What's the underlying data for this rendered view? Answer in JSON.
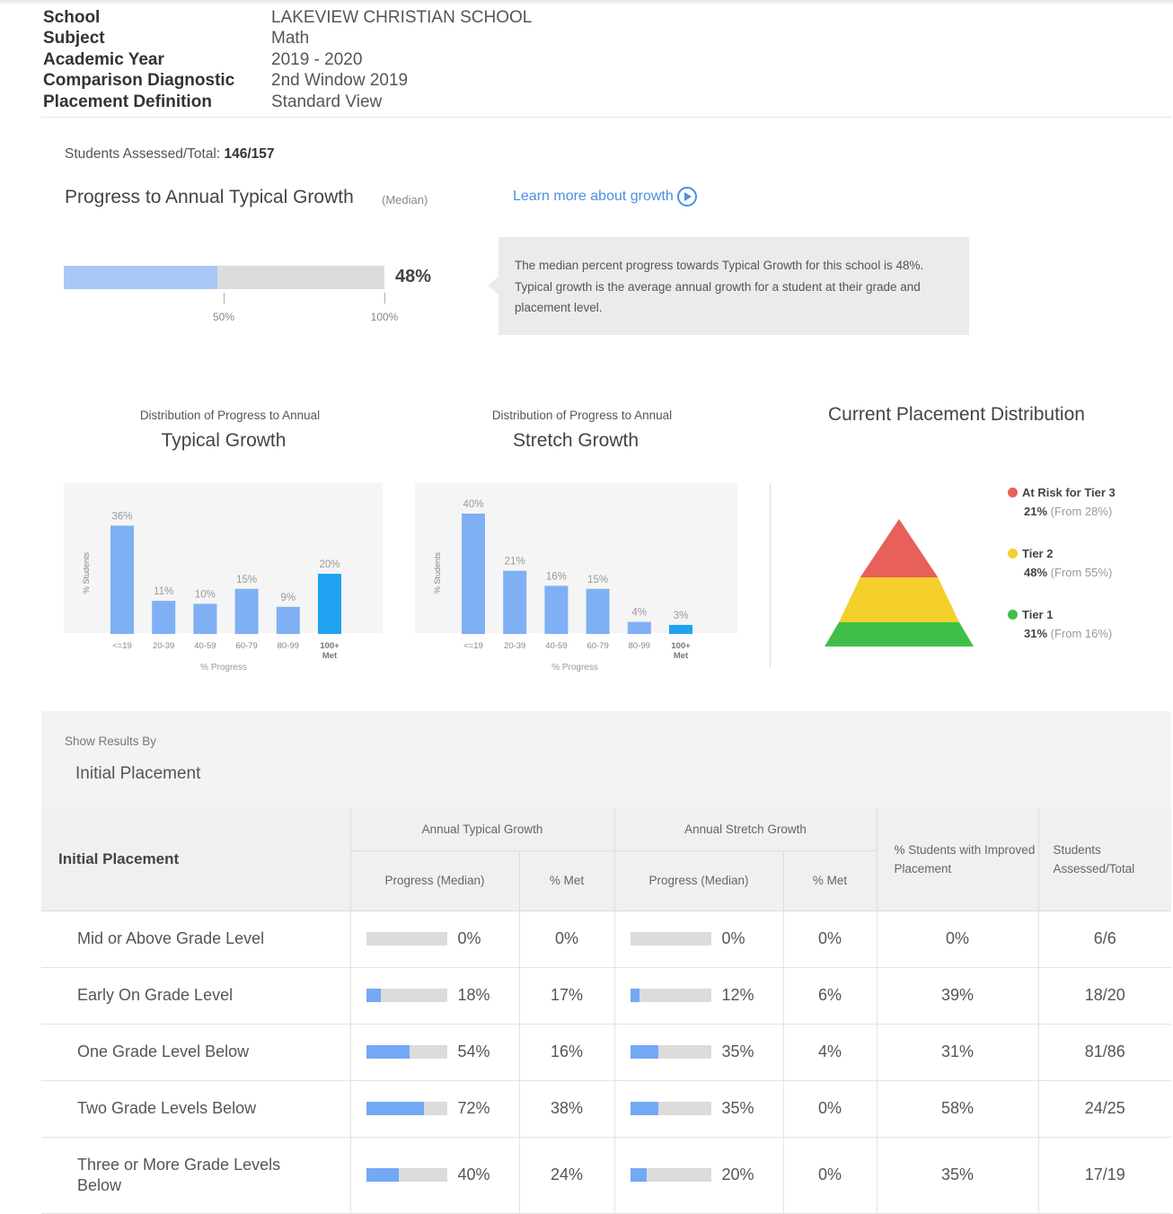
{
  "meta": {
    "school_label": "School",
    "school": "LAKEVIEW CHRISTIAN SCHOOL",
    "subject_label": "Subject",
    "subject": "Math",
    "year_label": "Academic Year",
    "year": "2019 - 2020",
    "comparison_label": "Comparison Diagnostic",
    "comparison": "2nd Window 2019",
    "placement_label": "Placement Definition",
    "placement": "Standard View"
  },
  "summary": {
    "assessed_label": "Students Assessed/Total:",
    "assessed_value": "146/157",
    "progress_title": "Progress to Annual Typical Growth",
    "progress_sub": "(Median)",
    "learn_more": "Learn more about growth",
    "progress_value": 48,
    "progress_pct": "48%",
    "tick_50": "50%",
    "tick_100": "100%",
    "tooltip": "The median percent progress towards Typical Growth for this school is 48%. Typical growth is the average annual growth for a student at their grade and placement level."
  },
  "chart_data": [
    {
      "type": "bar",
      "small_title": "Distribution of Progress to Annual",
      "title": "Typical Growth",
      "categories": [
        "<=19",
        "20-39",
        "40-59",
        "60-79",
        "80-99",
        "100+ Met"
      ],
      "values": [
        36,
        11,
        10,
        15,
        9,
        20
      ],
      "labels": [
        "36%",
        "11%",
        "10%",
        "15%",
        "9%",
        "20%"
      ],
      "ylabel": "% Students",
      "xlabel": "% Progress",
      "colors": [
        "#7fb0f3",
        "#7fb0f3",
        "#7fb0f3",
        "#7fb0f3",
        "#7fb0f3",
        "#1fa3f0"
      ],
      "ylim": [
        0,
        40
      ]
    },
    {
      "type": "bar",
      "small_title": "Distribution of Progress to Annual",
      "title": "Stretch Growth",
      "categories": [
        "<=19",
        "20-39",
        "40-59",
        "60-79",
        "80-99",
        "100+ Met"
      ],
      "values": [
        40,
        21,
        16,
        15,
        4,
        3
      ],
      "labels": [
        "40%",
        "21%",
        "16%",
        "15%",
        "4%",
        "3%"
      ],
      "ylabel": "% Students",
      "xlabel": "% Progress",
      "colors": [
        "#7fb0f3",
        "#7fb0f3",
        "#7fb0f3",
        "#7fb0f3",
        "#7fb0f3",
        "#1fa3f0"
      ],
      "ylim": [
        0,
        40
      ]
    }
  ],
  "placement": {
    "title": "Current Placement Distribution",
    "tiers": [
      {
        "name": "At Risk for Tier 3",
        "pct": "21%",
        "from": "(From 28%)",
        "color": "#e8605a"
      },
      {
        "name": "Tier 2",
        "pct": "48%",
        "from": "(From 55%)",
        "color": "#f5cf2a"
      },
      {
        "name": "Tier 1",
        "pct": "31%",
        "from": "(From 16%)",
        "color": "#3fbf4a"
      }
    ]
  },
  "results": {
    "show_by": "Show Results By",
    "selected": "Initial Placement",
    "headers": {
      "initial_placement": "Initial Placement",
      "typical": "Annual Typical Growth",
      "stretch": "Annual Stretch Growth",
      "progress_median": "Progress (Median)",
      "pct_met": "% Met",
      "improved": "% Students with Improved Placement",
      "assessed": "Students Assessed/Total"
    },
    "rows": [
      {
        "name": "Mid or Above Grade Level",
        "typical_progress": 0,
        "typical_label": "0%",
        "typical_met": "0%",
        "stretch_progress": 0,
        "stretch_label": "0%",
        "stretch_met": "0%",
        "improved": "0%",
        "assessed": "6/6"
      },
      {
        "name": "Early On Grade Level",
        "typical_progress": 18,
        "typical_label": "18%",
        "typical_met": "17%",
        "stretch_progress": 12,
        "stretch_label": "12%",
        "stretch_met": "6%",
        "improved": "39%",
        "assessed": "18/20"
      },
      {
        "name": "One Grade Level Below",
        "typical_progress": 54,
        "typical_label": "54%",
        "typical_met": "16%",
        "stretch_progress": 35,
        "stretch_label": "35%",
        "stretch_met": "4%",
        "improved": "31%",
        "assessed": "81/86"
      },
      {
        "name": "Two Grade Levels Below",
        "typical_progress": 72,
        "typical_label": "72%",
        "typical_met": "38%",
        "stretch_progress": 35,
        "stretch_label": "35%",
        "stretch_met": "0%",
        "improved": "58%",
        "assessed": "24/25"
      },
      {
        "name": "Three or More Grade Levels Below",
        "typical_progress": 40,
        "typical_label": "40%",
        "typical_met": "24%",
        "stretch_progress": 20,
        "stretch_label": "20%",
        "stretch_met": "0%",
        "improved": "35%",
        "assessed": "17/19"
      }
    ]
  }
}
